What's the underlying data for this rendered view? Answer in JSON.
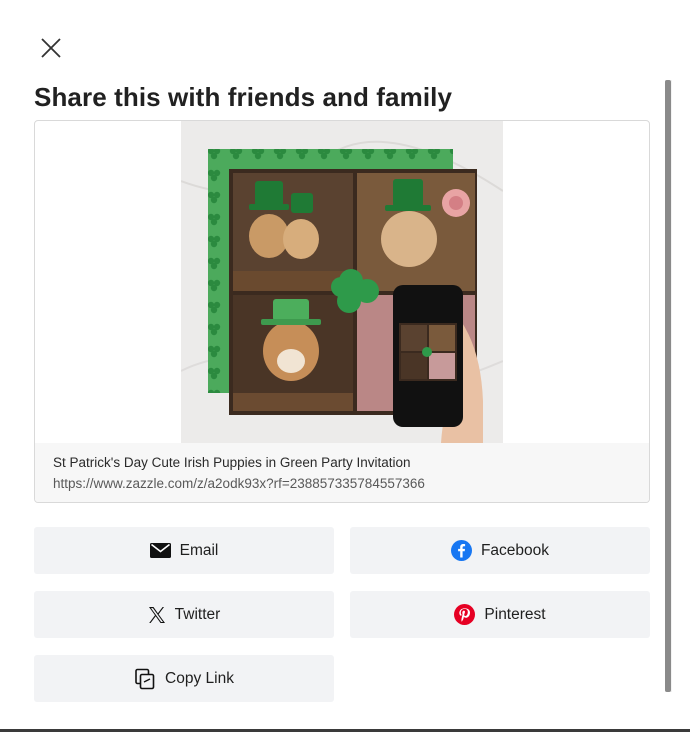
{
  "dialog": {
    "title": "Share this with friends and family"
  },
  "product": {
    "name": "St Patrick's Day Cute Irish Puppies in Green Party Invitation",
    "url": "https://www.zazzle.com/z/a2odk93x?rf=238857335784557366"
  },
  "share_buttons": {
    "email": "Email",
    "facebook": "Facebook",
    "twitter": "Twitter",
    "pinterest": "Pinterest",
    "copy_link": "Copy Link"
  },
  "icons": {
    "close": "close-icon",
    "email": "envelope-icon",
    "facebook": "facebook-icon",
    "twitter": "x-twitter-icon",
    "pinterest": "pinterest-icon",
    "copy": "copy-link-icon"
  },
  "colors": {
    "facebook": "#1877f2",
    "pinterest": "#e60023",
    "button_bg": "#f2f3f5",
    "shamrock_green": "#2e9a4a"
  }
}
